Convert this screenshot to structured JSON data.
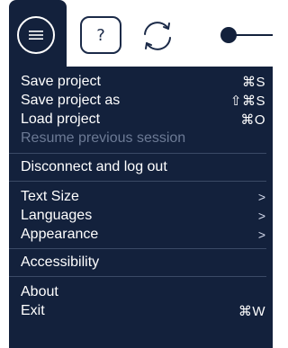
{
  "toolbar": {
    "menu_icon": "hamburger-menu-icon",
    "help_label": "?",
    "help_icon": "question-icon",
    "refresh_icon": "refresh-icon",
    "slider_icon": "slider-icon"
  },
  "menu": {
    "groups": [
      {
        "items": [
          {
            "label": "Save project",
            "shortcut": "⌘S"
          },
          {
            "label": "Save project as",
            "shortcut": "⇧⌘S"
          },
          {
            "label": "Load project",
            "shortcut": "⌘O"
          },
          {
            "label": "Resume previous session",
            "disabled": true
          }
        ]
      },
      {
        "items": [
          {
            "label": "Disconnect and log out"
          }
        ]
      },
      {
        "items": [
          {
            "label": "Text Size",
            "submenu_arrow": ">"
          },
          {
            "label": "Languages",
            "submenu_arrow": ">"
          },
          {
            "label": "Appearance",
            "submenu_arrow": ">"
          }
        ]
      },
      {
        "items": [
          {
            "label": "Accessibility"
          }
        ]
      },
      {
        "items": [
          {
            "label": "About"
          },
          {
            "label": "Exit",
            "shortcut": "⌘W"
          }
        ]
      }
    ]
  },
  "colors": {
    "menu_background": "#13213c",
    "menu_text": "#ffffff",
    "disabled_text": "#6c7a95",
    "separator": "#3b4a66"
  }
}
